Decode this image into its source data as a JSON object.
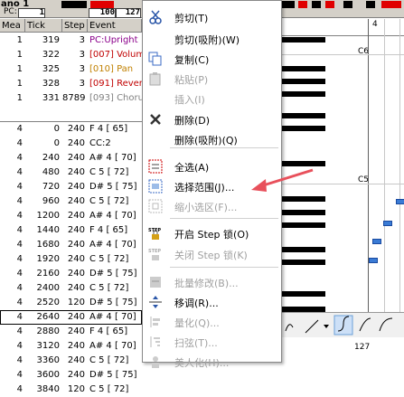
{
  "window": {
    "title": "ano 1",
    "pc_label": "PC:",
    "pc_value": "1",
    "meter1": "100",
    "meter2": "127"
  },
  "list": {
    "columns": [
      "Mea",
      "Tick",
      "Step",
      "Event"
    ],
    "rows": [
      {
        "mea": "1",
        "tick": "319",
        "step": "3",
        "event": "PC:Upright",
        "color": "#8b008b"
      },
      {
        "mea": "1",
        "tick": "322",
        "step": "3",
        "event": "[007] Volum",
        "color": "#c00000"
      },
      {
        "mea": "1",
        "tick": "325",
        "step": "3",
        "event": "[010] Pan",
        "color": "#c08000"
      },
      {
        "mea": "1",
        "tick": "328",
        "step": "3",
        "event": "[091] Rever",
        "color": "#c00000"
      },
      {
        "mea": "1",
        "tick": "331",
        "step": "8789",
        "event": "[093] Choru",
        "color": "#808080"
      },
      {
        "mea": "4",
        "tick": "0",
        "step": "240",
        "event": "F 4 [ 65]",
        "color": "#000000"
      },
      {
        "mea": "4",
        "tick": "0",
        "step": "240",
        "event": "CC:2",
        "color": "#000000"
      },
      {
        "mea": "4",
        "tick": "240",
        "step": "240",
        "event": "A# 4 [ 70]",
        "color": "#000000"
      },
      {
        "mea": "4",
        "tick": "480",
        "step": "240",
        "event": "C 5 [ 72]",
        "color": "#000000"
      },
      {
        "mea": "4",
        "tick": "720",
        "step": "240",
        "event": "D# 5 [ 75]",
        "color": "#000000"
      },
      {
        "mea": "4",
        "tick": "960",
        "step": "240",
        "event": "C 5 [ 72]",
        "color": "#000000"
      },
      {
        "mea": "4",
        "tick": "1200",
        "step": "240",
        "event": "A# 4 [ 70]",
        "color": "#000000"
      },
      {
        "mea": "4",
        "tick": "1440",
        "step": "240",
        "event": "F 4 [ 65]",
        "color": "#000000"
      },
      {
        "mea": "4",
        "tick": "1680",
        "step": "240",
        "event": "A# 4 [ 70]",
        "color": "#000000"
      },
      {
        "mea": "4",
        "tick": "1920",
        "step": "240",
        "event": "C 5 [ 72]",
        "color": "#000000"
      },
      {
        "mea": "4",
        "tick": "2160",
        "step": "240",
        "event": "D# 5 [ 75]",
        "color": "#000000"
      },
      {
        "mea": "4",
        "tick": "2400",
        "step": "240",
        "event": "C 5 [ 72]",
        "color": "#000000"
      },
      {
        "mea": "4",
        "tick": "2520",
        "step": "120",
        "event": "D# 5 [ 75]",
        "color": "#000000"
      },
      {
        "mea": "4",
        "tick": "2640",
        "step": "240",
        "event": "A# 4 [ 70]",
        "color": "#000000"
      },
      {
        "mea": "4",
        "tick": "2880",
        "step": "240",
        "event": "F 4 [ 65]",
        "color": "#000000"
      },
      {
        "mea": "4",
        "tick": "3120",
        "step": "240",
        "event": "A# 4 [ 70]",
        "color": "#000000"
      },
      {
        "mea": "4",
        "tick": "3360",
        "step": "240",
        "event": "C 5 [ 72]",
        "color": "#000000"
      },
      {
        "mea": "4",
        "tick": "3600",
        "step": "240",
        "event": "D# 5 [ 75]",
        "color": "#000000"
      },
      {
        "mea": "4",
        "tick": "3840",
        "step": "120",
        "event": "C 5 [ 72]",
        "color": "#000000"
      }
    ]
  },
  "roll": {
    "label_top": "4",
    "label_c6": "C6",
    "label_c5": "C5",
    "bottom_value": "127"
  },
  "menu": {
    "items": [
      {
        "label": "剪切(T)",
        "icon": "scissors-icon",
        "enabled": true
      },
      {
        "label": "剪切(吸附)(W)",
        "icon": "",
        "enabled": true
      },
      {
        "label": "复制(C)",
        "icon": "copy-icon",
        "enabled": true
      },
      {
        "label": "粘贴(P)",
        "icon": "paste-icon",
        "enabled": false
      },
      {
        "label": "插入(I)",
        "icon": "",
        "enabled": false
      },
      {
        "label": "删除(D)",
        "icon": "delete-x-icon",
        "enabled": true
      },
      {
        "label": "删除(吸附)(Q)",
        "icon": "",
        "enabled": true
      },
      {
        "label": "全选(A)",
        "icon": "select-all-icon",
        "enabled": true
      },
      {
        "label": "选择范围(J)...",
        "icon": "select-range-icon",
        "enabled": true
      },
      {
        "label": "缩小选区(F)...",
        "icon": "shrink-selection-icon",
        "enabled": false
      },
      {
        "label": "开启 Step 锁(O)",
        "icon": "step-lock-on-icon",
        "enabled": true
      },
      {
        "label": "关闭 Step 锁(K)",
        "icon": "step-lock-off-icon",
        "enabled": false
      },
      {
        "label": "批量修改(B)...",
        "icon": "batch-edit-icon",
        "enabled": false
      },
      {
        "label": "移调(R)...",
        "icon": "transpose-icon",
        "enabled": true
      },
      {
        "label": "量化(Q)...",
        "icon": "quantize-icon",
        "enabled": false
      },
      {
        "label": "扫弦(T)...",
        "icon": "strum-icon",
        "enabled": false
      },
      {
        "label": "美人化(H)...",
        "icon": "humanize-icon",
        "enabled": false
      }
    ]
  },
  "colors": {
    "accent_red": "#e8505b",
    "selection_blue": "#3a7bd5"
  }
}
